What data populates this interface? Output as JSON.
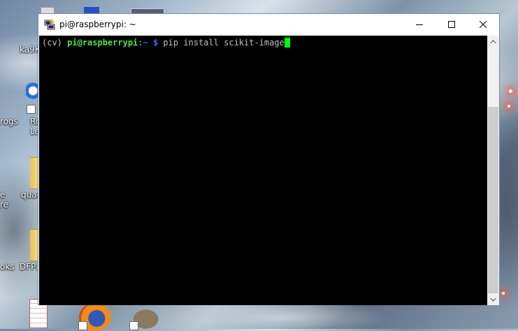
{
  "desktop": {
    "labels": {
      "ka9": "ka9K",
      "rogs": "rogs",
      "ro": "Ro",
      "le": "Le",
      "e": "e",
      "re": "re",
      "quad": "quad",
      "oks": "oks",
      "dfpl": "DFPla"
    }
  },
  "window": {
    "title": "pi@raspberrypi: ~",
    "controls": {
      "minimize": "minimize",
      "maximize": "maximize",
      "close": "close"
    }
  },
  "terminal": {
    "env": "(cv) ",
    "user_host": "pi@raspberrypi",
    "colon": ":",
    "path": "~ $",
    "command": " pip install scikit-image"
  },
  "colors": {
    "prompt_green": "#4ee34e",
    "prompt_blue": "#4a5cff",
    "cursor": "#00ff00",
    "terminal_bg": "#000000"
  }
}
